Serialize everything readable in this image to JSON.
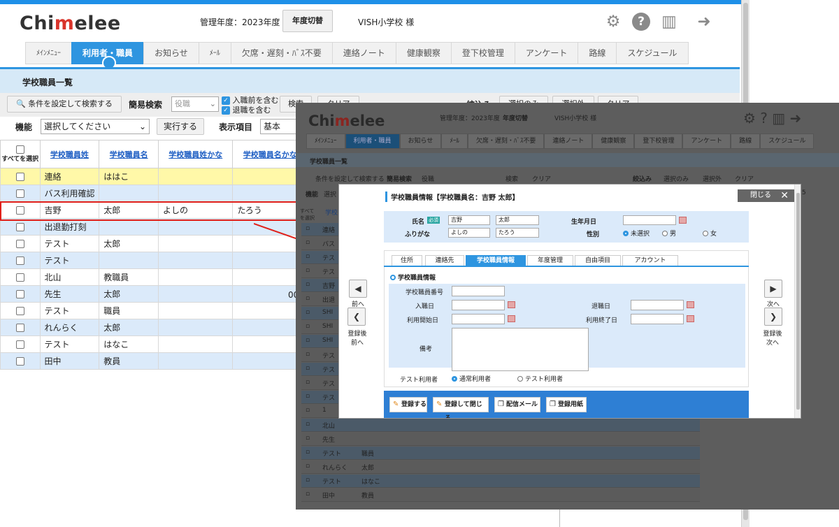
{
  "header": {
    "logo_text": "Chi",
    "logo_mid": "m",
    "logo_rest": "elee",
    "year_label": "管理年度：2023年度",
    "year_switch": "年度切替",
    "school": "VISH小学校 様",
    "icons": [
      "gear-icon",
      "help-icon",
      "book-icon",
      "logout-icon"
    ]
  },
  "nav": {
    "items": [
      "ﾒｲﾝﾒﾆｭｰ",
      "利用者・職員",
      "お知らせ",
      "ﾒｰﾙ",
      "欠席・遅刻・ﾊﾞｽ不要",
      "連絡ノート",
      "健康観察",
      "登下校管理",
      "アンケート",
      "路線",
      "スケジュール"
    ],
    "active_index": 1
  },
  "page": {
    "title": "学校職員一覧",
    "search_cond_button": "条件を設定して検索する",
    "simple_search_label": "簡易検索",
    "role_placeholder": "役職",
    "check_before_join": "入職前を含む",
    "check_retired": "退職を含む",
    "search_button": "検索",
    "clear_button": "クリア",
    "narrow_label": "絞込み",
    "select_only": "選択のみ",
    "exclude_selected": "選択外",
    "clear2": "クリア",
    "func_label": "機能",
    "func_select": "選択してください",
    "execute_button": "実行する",
    "display_label": "表示項目",
    "display_select": "基本"
  },
  "table": {
    "select_all": "すべてを選択",
    "headers": [
      "学校職員姓",
      "学校職員名",
      "学校職員姓かな",
      "学校職員名かな"
    ],
    "rows": [
      {
        "sei": "連絡",
        "mei": "ははこ",
        "seikana": "",
        "meikana": "",
        "style": "yellow"
      },
      {
        "sei": "バス利用確認",
        "mei": "",
        "seikana": "",
        "meikana": "",
        "style": "blue"
      },
      {
        "sei": "吉野",
        "mei": "太郎",
        "seikana": "よしの",
        "meikana": "たろう",
        "style": "white"
      },
      {
        "sei": "出退勤打刻",
        "mei": "",
        "seikana": "",
        "meikana": "",
        "style": "blue"
      },
      {
        "sei": "テスト",
        "mei": "太郎",
        "seikana": "",
        "meikana": "",
        "style": "white"
      },
      {
        "sei": "テスト",
        "mei": "",
        "seikana": "",
        "meikana": "",
        "style": "blue"
      },
      {
        "sei": "北山",
        "mei": "教職員",
        "seikana": "",
        "meikana": "",
        "style": "white"
      },
      {
        "sei": "先生",
        "mei": "太郎",
        "seikana": "",
        "meikana": "",
        "style": "blue"
      },
      {
        "sei": "テスト",
        "mei": "職員",
        "seikana": "",
        "meikana": "",
        "style": "white"
      },
      {
        "sei": "れんらく",
        "mei": "太郎",
        "seikana": "",
        "meikana": "",
        "style": "blue"
      },
      {
        "sei": "テスト",
        "mei": "はなこ",
        "seikana": "",
        "meikana": "",
        "style": "white"
      },
      {
        "sei": "田中",
        "mei": "教員",
        "seikana": "",
        "meikana": "",
        "style": "blue"
      }
    ],
    "partial_cell": "00"
  },
  "modal": {
    "title": "学校職員情報【学校職員名：吉野 太郎】",
    "close": "閉じる",
    "name_label": "氏名",
    "required": "必須",
    "sei": "吉野",
    "mei": "太郎",
    "kana_label": "ふりがな",
    "sei_kana": "よしの",
    "mei_kana": "たろう",
    "birth_label": "生年月日",
    "gender_label": "性別",
    "gender_unset": "未選択",
    "gender_male": "男",
    "gender_female": "女",
    "tabs": [
      "住所",
      "連絡先",
      "学校職員情報",
      "年度管理",
      "自由項目",
      "アカウント"
    ],
    "section_title": "学校職員情報",
    "staff_no": "学校職員番号",
    "join_date": "入職日",
    "retire_date": "退職日",
    "use_start": "利用開始日",
    "use_end": "利用終了日",
    "note": "備考",
    "test_user_label": "テスト利用者",
    "normal_user": "通常利用者",
    "test_user": "テスト利用者",
    "prev": "前へ",
    "next": "次へ",
    "reg_prev": "登録後\n前へ",
    "reg_next": "登録後\n次へ",
    "btn_register": "登録する",
    "btn_register_close": "登録して閉じる",
    "btn_mail": "配信メール",
    "btn_form": "登録用紙"
  },
  "overlay": {
    "year_label": "管理年度：2023年度",
    "year_switch": "年度切替",
    "school": "VISH小学校 様",
    "list_title": "学校職員一覧",
    "search_cond": "条件を設定して検索する",
    "simple": "簡易検索",
    "role": "役職",
    "search": "検索",
    "clear": "クリア",
    "narrow": "絞込み",
    "select_only": "選択のみ",
    "exclude": "選択外",
    "clear2": "クリア",
    "func": "機能",
    "func_sel": "選択",
    "select_all": "すべてを選択",
    "col_head": "学校",
    "rows": [
      "連絡",
      "バス",
      "テス",
      "テス",
      "吉野",
      "出退",
      "SHI",
      "SHI",
      "SHI",
      "テス",
      "テス",
      "テス",
      "テス",
      "1",
      "北山",
      "先生",
      "テスト",
      "れんらく",
      "テスト",
      "田中"
    ],
    "rows_mei": [
      "",
      "",
      "",
      "",
      "",
      "",
      "",
      "",
      "",
      "",
      "",
      "",
      "",
      "",
      "",
      "",
      "職員",
      "太郎",
      "はなこ",
      "教員"
    ],
    "counter": "5"
  }
}
